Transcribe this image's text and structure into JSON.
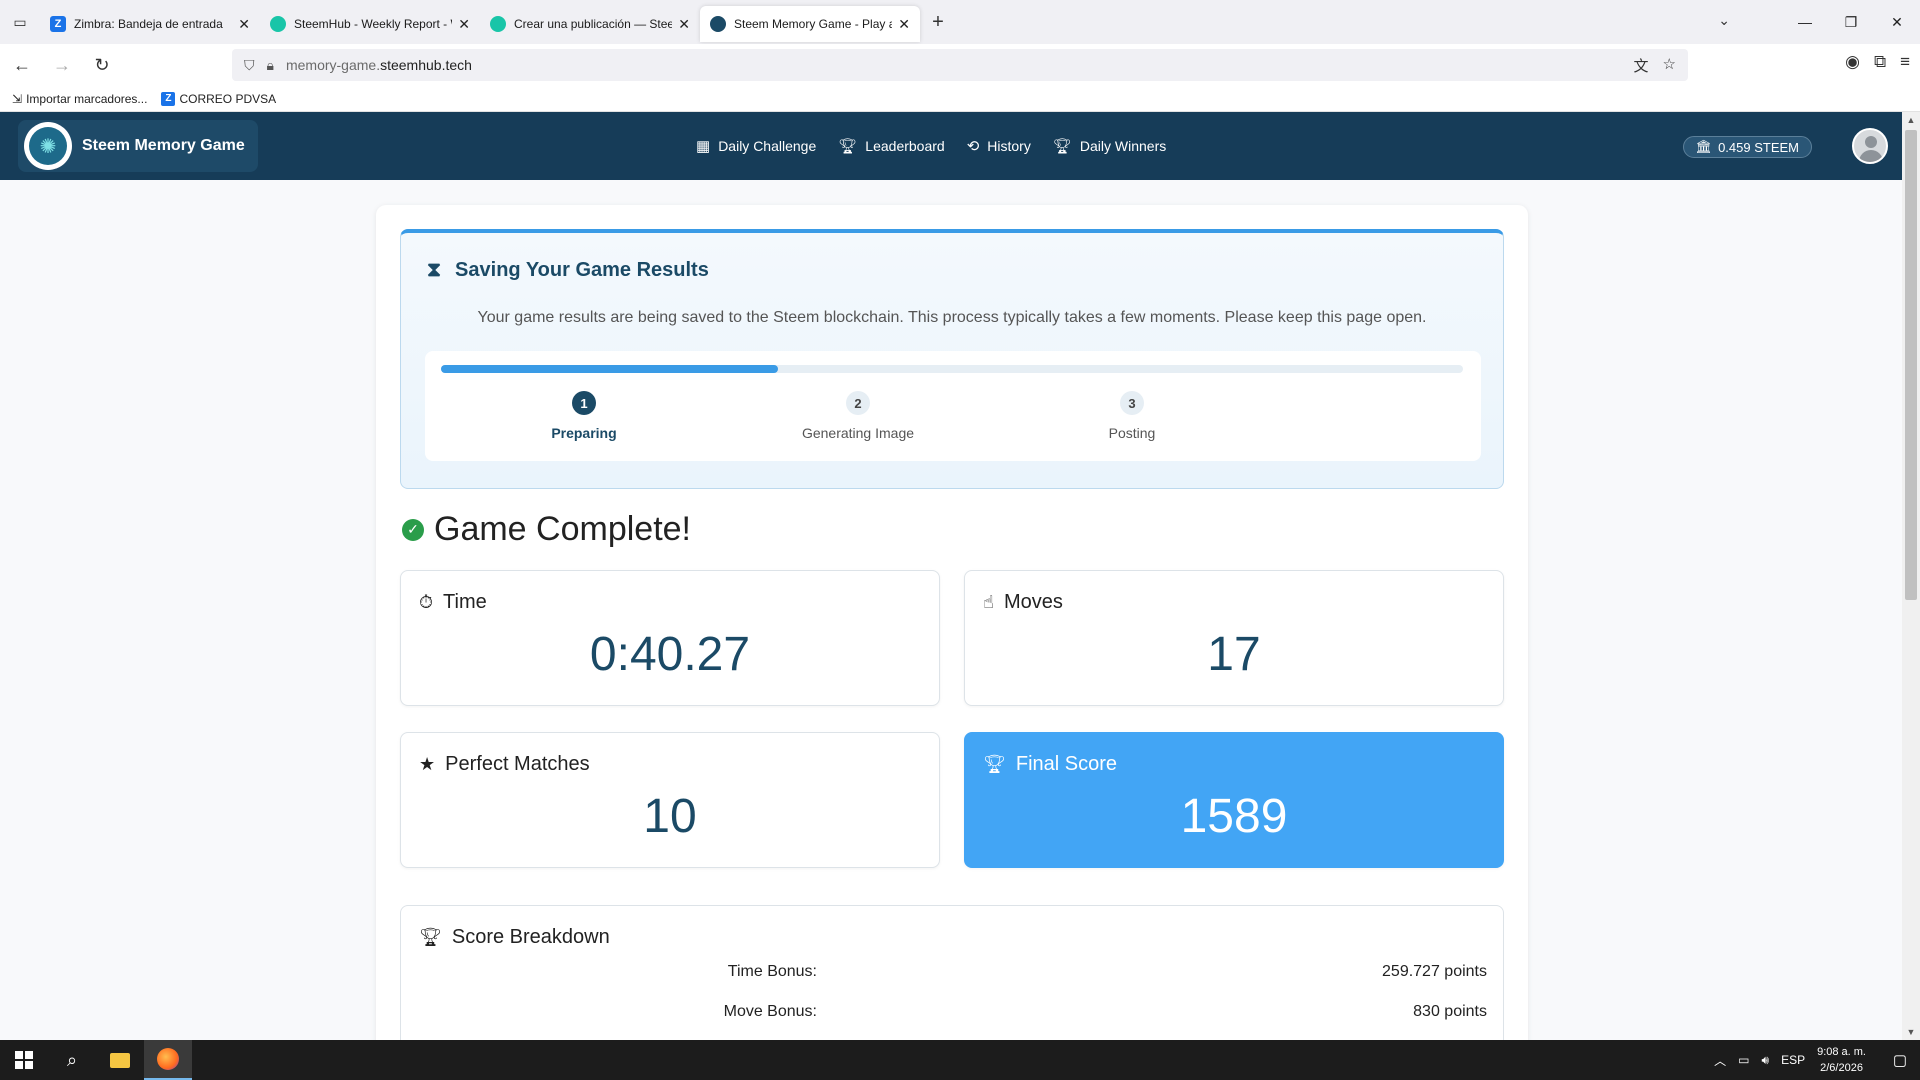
{
  "browser": {
    "tabs": [
      {
        "title": "Zimbra: Bandeja de entrada",
        "favicon": "Z",
        "active": false
      },
      {
        "title": "SteemHub - Weekly Report - W",
        "favicon": "",
        "active": false
      },
      {
        "title": "Crear una publicación — Steem",
        "favicon": "",
        "active": false
      },
      {
        "title": "Steem Memory Game - Play and",
        "favicon": "",
        "active": true
      }
    ],
    "url_prefix": "memory-game.",
    "url_domain": "steemhub.tech",
    "bookmarks": [
      {
        "label": "Importar marcadores..."
      },
      {
        "label": "CORREO PDVSA",
        "favicon": "Z"
      }
    ]
  },
  "app": {
    "brand": "Steem Memory Game",
    "nav": [
      {
        "label": "Daily Challenge",
        "icon": "calendar-icon"
      },
      {
        "label": "Leaderboard",
        "icon": "trophy-icon"
      },
      {
        "label": "History",
        "icon": "history-icon"
      },
      {
        "label": "Daily Winners",
        "icon": "trophy-icon"
      }
    ],
    "wallet": "0.459 STEEM"
  },
  "saving": {
    "title": "Saving Your Game Results",
    "description": "Your game results are being saved to the Steem blockchain. This process typically takes a few moments. Please keep this page open.",
    "progress": 0.33,
    "steps": [
      {
        "num": "1",
        "label": "Preparing",
        "active": true
      },
      {
        "num": "2",
        "label": "Generating Image",
        "active": false
      },
      {
        "num": "3",
        "label": "Posting",
        "active": false
      }
    ]
  },
  "result": {
    "heading": "Game Complete!",
    "time": {
      "label": "Time",
      "value": "0:40.27"
    },
    "moves": {
      "label": "Moves",
      "value": "17"
    },
    "perfect": {
      "label": "Perfect Matches",
      "value": "10"
    },
    "score": {
      "label": "Final Score",
      "value": "1589"
    }
  },
  "breakdown": {
    "title": "Score Breakdown",
    "rows": [
      {
        "label": "Time Bonus:",
        "value": "259.727 points"
      },
      {
        "label": "Move Bonus:",
        "value": "830 points"
      }
    ]
  },
  "taskbar": {
    "lang": "ESP",
    "time": "9:08 a. m.",
    "date": "2/6/2026"
  },
  "colors": {
    "header": "#163c58",
    "accent": "#3a9be6",
    "score_card": "#42a5f5",
    "value_text": "#1b4a66",
    "success": "#2a9d4a"
  }
}
